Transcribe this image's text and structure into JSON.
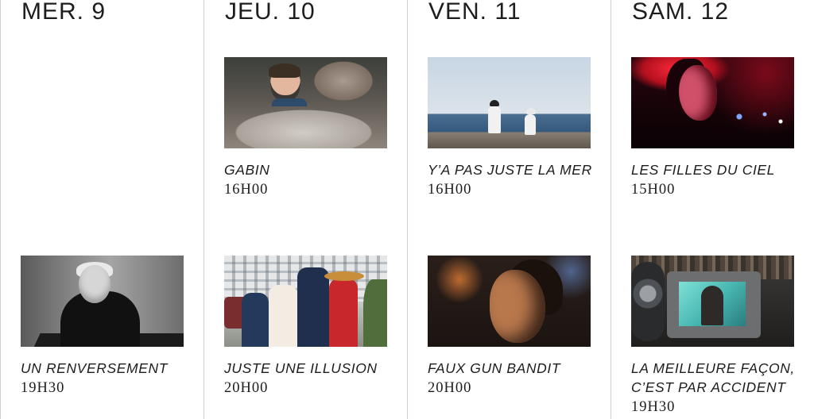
{
  "columns": [
    {
      "day": "MER. 9",
      "screenings": [
        null,
        {
          "title": "UN RENVERSEMENT",
          "time": "19H30",
          "image": "film-still-un-renversement"
        }
      ]
    },
    {
      "day": "JEU. 10",
      "screenings": [
        {
          "title": "GABIN",
          "time": "16H00",
          "image": "film-still-gabin"
        },
        {
          "title": "JUSTE UNE ILLUSION",
          "time": "20H00",
          "image": "film-still-juste-une-illusion"
        }
      ]
    },
    {
      "day": "VEN. 11",
      "screenings": [
        {
          "title": "Y’A PAS JUSTE LA MER",
          "time": "16H00",
          "image": "film-still-ya-pas-juste-la-mer"
        },
        {
          "title": "FAUX GUN BANDIT",
          "time": "20H00",
          "image": "film-still-faux-gun-bandit"
        }
      ]
    },
    {
      "day": "SAM. 12",
      "screenings": [
        {
          "title": "LES FILLES DU CIEL",
          "time": "15H00",
          "image": "film-still-les-filles-du-ciel"
        },
        {
          "title": "LA MEILLEURE FAÇON, C’EST PAR ACCIDENT",
          "time": "19H30",
          "image": "film-still-la-meilleure-facon"
        }
      ]
    }
  ],
  "colors": {
    "background": "#ffffff",
    "text": "#1d1d1d",
    "divider": "#cfcfcf"
  }
}
